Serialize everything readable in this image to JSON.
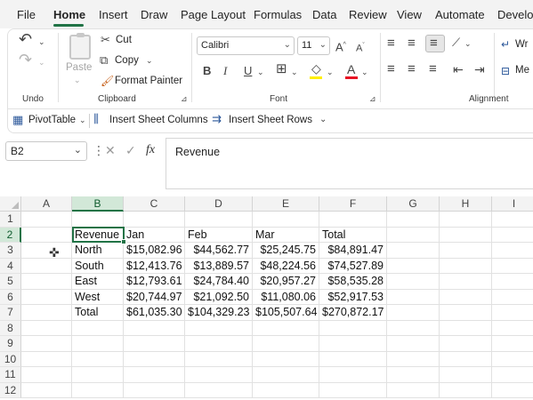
{
  "menu": {
    "items": [
      "File",
      "Home",
      "Insert",
      "Draw",
      "Page Layout",
      "Formulas",
      "Data",
      "Review",
      "View",
      "Automate",
      "Develop"
    ],
    "active": "Home"
  },
  "ribbon": {
    "undo": {
      "group_label": "Undo"
    },
    "clipboard": {
      "paste_label": "Paste",
      "cut_label": "Cut",
      "copy_label": "Copy",
      "format_painter_label": "Format Painter",
      "group_label": "Clipboard"
    },
    "font": {
      "font_name": "Calibri",
      "font_size": "11",
      "group_label": "Font",
      "bold": "B",
      "italic": "I",
      "underline": "U",
      "font_color_letter": "A",
      "grow_letter": "A",
      "shrink_letter": "A"
    },
    "alignment": {
      "group_label": "Alignment",
      "wrap_label": "Wr",
      "merge_label": "Me"
    },
    "quick": {
      "pivot_label": "PivotTable",
      "insert_cols_label": "Insert Sheet Columns",
      "insert_rows_label": "Insert Sheet Rows"
    }
  },
  "formula_bar": {
    "name_box": "B2",
    "content": "Revenue",
    "fx": "fx"
  },
  "grid": {
    "columns": [
      "A",
      "B",
      "C",
      "D",
      "E",
      "F",
      "G",
      "H",
      "I"
    ],
    "selected_column": "B",
    "selected_row": "2",
    "rows": [
      {
        "num": "1",
        "cells": [
          "",
          "",
          "",
          "",
          "",
          "",
          "",
          "",
          ""
        ]
      },
      {
        "num": "2",
        "cells": [
          "",
          "Revenue",
          "Jan",
          "Feb",
          "Mar",
          "Total",
          "",
          "",
          ""
        ]
      },
      {
        "num": "3",
        "cells": [
          "",
          "North",
          "$15,082.96",
          "$44,562.77",
          "$25,245.75",
          "$84,891.47",
          "",
          "",
          ""
        ]
      },
      {
        "num": "4",
        "cells": [
          "",
          "South",
          "$12,413.76",
          "$13,889.57",
          "$48,224.56",
          "$74,527.89",
          "",
          "",
          ""
        ]
      },
      {
        "num": "5",
        "cells": [
          "",
          "East",
          "$12,793.61",
          "$24,784.40",
          "$20,957.27",
          "$58,535.28",
          "",
          "",
          ""
        ]
      },
      {
        "num": "6",
        "cells": [
          "",
          "West",
          "$20,744.97",
          "$21,092.50",
          "$11,080.06",
          "$52,917.53",
          "",
          "",
          ""
        ]
      },
      {
        "num": "7",
        "cells": [
          "",
          "Total",
          "$61,035.30",
          "$104,329.23",
          "$105,507.64",
          "$270,872.17",
          "",
          "",
          ""
        ]
      },
      {
        "num": "8",
        "cells": [
          "",
          "",
          "",
          "",
          "",
          "",
          "",
          "",
          ""
        ]
      },
      {
        "num": "9",
        "cells": [
          "",
          "",
          "",
          "",
          "",
          "",
          "",
          "",
          ""
        ]
      },
      {
        "num": "10",
        "cells": [
          "",
          "",
          "",
          "",
          "",
          "",
          "",
          "",
          ""
        ]
      },
      {
        "num": "11",
        "cells": [
          "",
          "",
          "",
          "",
          "",
          "",
          "",
          "",
          ""
        ]
      },
      {
        "num": "12",
        "cells": [
          "",
          "",
          "",
          "",
          "",
          "",
          "",
          "",
          ""
        ]
      }
    ]
  },
  "colors": {
    "accent": "#217346",
    "font_color_bar": "#e81123",
    "highlight_bar": "#ffef00"
  }
}
